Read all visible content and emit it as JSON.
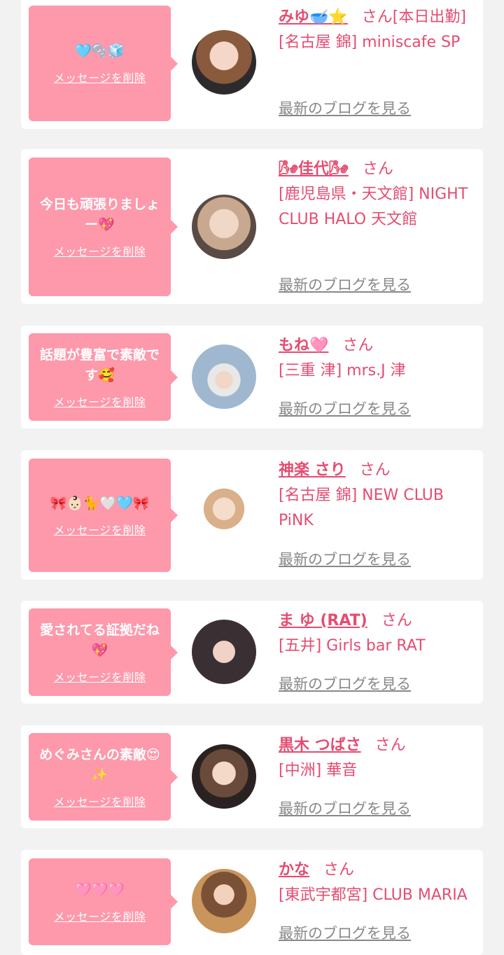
{
  "delete_label": "メッセージを削除",
  "blog_label": "最新のブログを見る",
  "san_label": "さん",
  "colors": {
    "accent": "#e54c70",
    "bubble": "#fe98ab",
    "background": "#f2f2f2"
  },
  "entries": [
    {
      "message": "🩵🫧🧊",
      "name": "みゆ🥣⭐",
      "suffix": "さん[本日出勤]",
      "shop": "[名古屋 錦] miniscafe SP"
    },
    {
      "message": "今日も頑張りましょー💖",
      "name": "🌬佳代🌬",
      "suffix": "さん",
      "shop": "[鹿児島県・天文館] NIGHT CLUB HALO 天文館"
    },
    {
      "message": "話題が豊富で素敵です🥰",
      "name": "もね🩷",
      "suffix": "さん",
      "shop": "[三重 津] mrs.J 津"
    },
    {
      "message": "🎀👶🏻🐈🤍🩵🎀",
      "name": "神楽 さり",
      "suffix": "さん",
      "shop": "[名古屋 錦] NEW CLUB PiNK"
    },
    {
      "message": "愛されてる証拠だね💖",
      "name": "ま ゆ (RAT)",
      "suffix": "さん",
      "shop": "[五井] Girls bar RAT"
    },
    {
      "message": "めぐみさんの素敵😍✨",
      "name": "黒木 つばさ",
      "suffix": "さん",
      "shop": "[中洲] 華音"
    },
    {
      "message": "🩷🩷🩷",
      "name": "かな",
      "suffix": "さん",
      "shop": "[東武宇都宮] CLUB MARIA"
    }
  ]
}
